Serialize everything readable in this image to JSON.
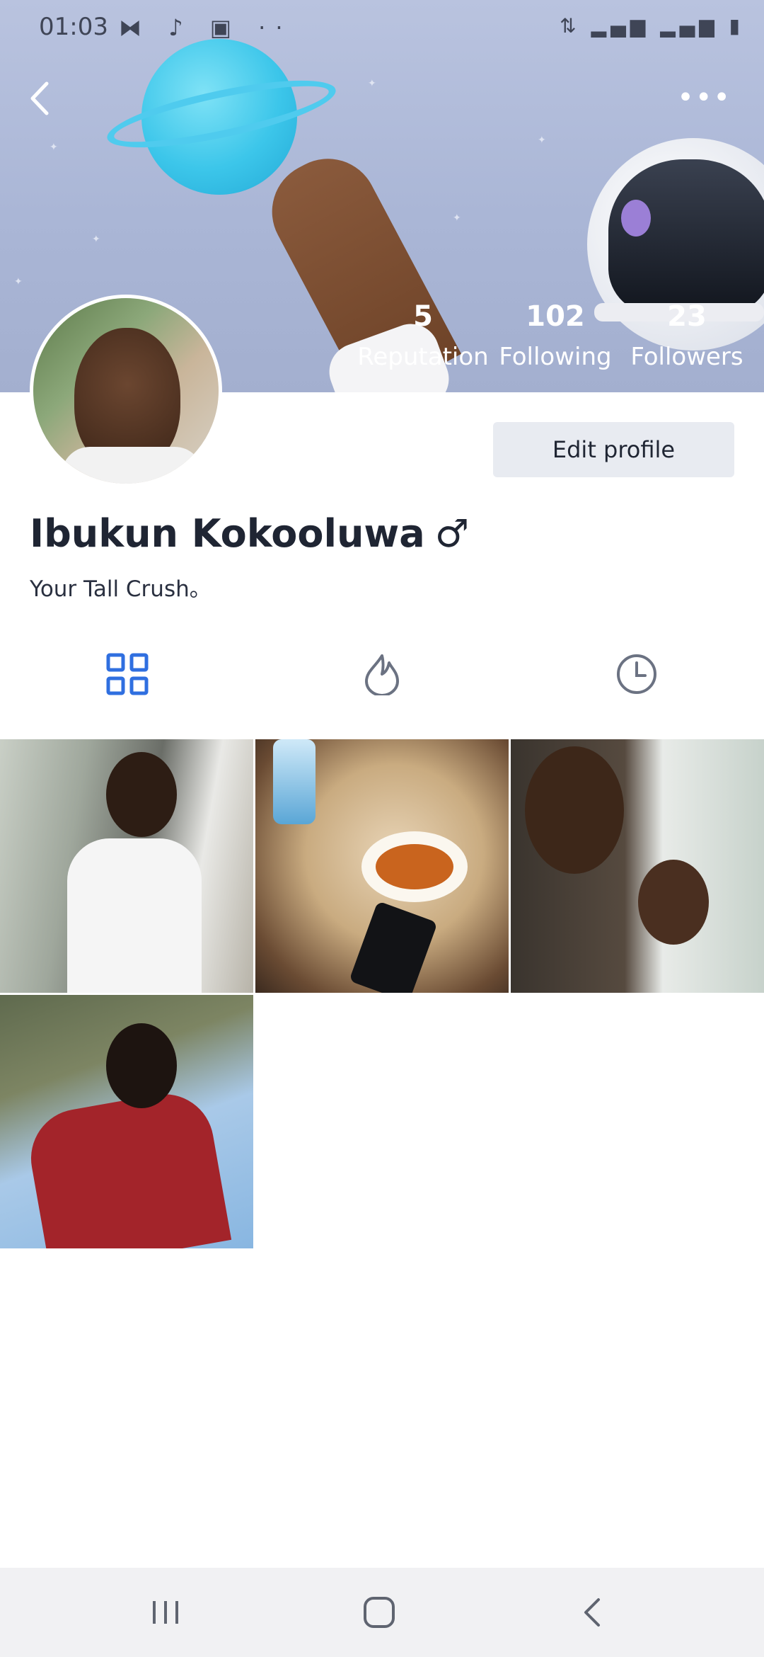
{
  "status_bar": {
    "time": "01:03",
    "notification_icons": [
      "m-icon",
      "music-note-icon",
      "image-icon",
      "more-dots-icon"
    ],
    "system_icons": [
      "h-plus-icon",
      "signal-icon",
      "signal-icon",
      "battery-icon"
    ]
  },
  "header": {
    "back_icon": "chevron-left-icon",
    "more_icon": "more-horizontal-icon"
  },
  "stats": [
    {
      "value": "5",
      "label": "Reputation"
    },
    {
      "value": "102",
      "label": "Following"
    },
    {
      "value": "23",
      "label": "Followers"
    }
  ],
  "profile": {
    "name": "Ibukun Kokooluwa",
    "gender_symbol": "♂",
    "bio": "Your Tall Crush。",
    "edit_label": "Edit profile"
  },
  "tabs": [
    {
      "icon": "grid-icon",
      "active": true
    },
    {
      "icon": "flame-icon",
      "active": false
    },
    {
      "icon": "clock-icon",
      "active": false
    }
  ],
  "photos": [
    {
      "icon": "photo-man-glasses"
    },
    {
      "icon": "photo-food-table"
    },
    {
      "icon": "photo-two-men-selfie"
    },
    {
      "icon": "photo-man-red-shirt"
    }
  ],
  "colors": {
    "accent": "#2f6fe0",
    "tab_inactive": "#6b7282",
    "edit_bg": "#e8ebf1",
    "navbar_bg": "#f1f1f3"
  }
}
